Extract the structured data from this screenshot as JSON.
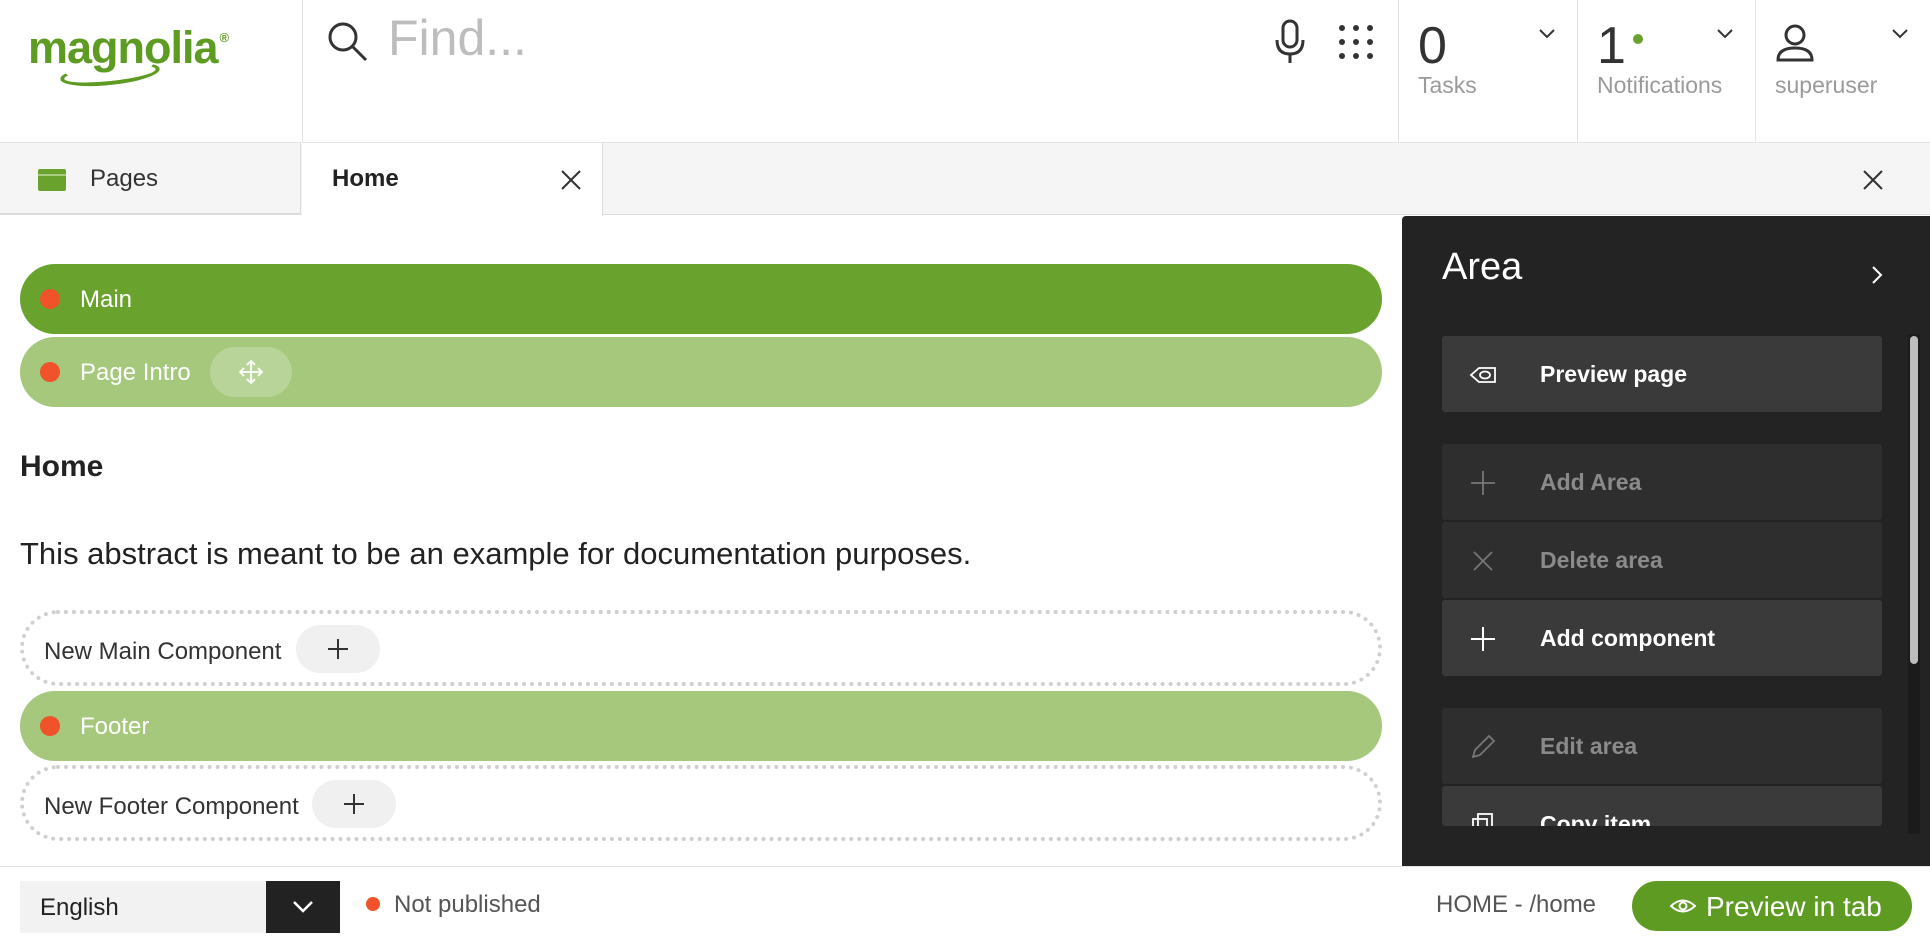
{
  "header": {
    "logo_text": "magnolia",
    "logo_mark": "®",
    "search": {
      "placeholder": "Find...",
      "value": ""
    },
    "tasks": {
      "count": "0",
      "label": "Tasks"
    },
    "notifications": {
      "count": "1",
      "label": "Notifications"
    },
    "user": {
      "label": "superuser"
    }
  },
  "tabs": {
    "pages_label": "Pages",
    "home_label": "Home"
  },
  "page": {
    "areas": {
      "main_label": "Main",
      "intro_label": "Page Intro",
      "footer_label": "Footer"
    },
    "heading": "Home",
    "abstract": "This abstract is meant to be an example for documentation purposes.",
    "new_main_component": "New Main Component",
    "new_footer_component": "New Footer Component"
  },
  "panel": {
    "title": "Area",
    "actions": {
      "preview": "Preview page",
      "add_area": "Add Area",
      "delete_area": "Delete area",
      "add_component": "Add component",
      "edit_area": "Edit area",
      "copy_item": "Copy item"
    }
  },
  "statusbar": {
    "language": "English",
    "publish_status": "Not published",
    "path": "HOME - /home",
    "preview_in_tab": "Preview in tab"
  },
  "colors": {
    "brand_green": "#5e9b22",
    "area_green": "#6aa22e",
    "area_light_green": "#a6c87d",
    "status_red": "#f0522a",
    "panel_dark": "#232323"
  },
  "icons": [
    "search-icon",
    "microphone-icon",
    "apps-grid-icon",
    "chevron-down-icon",
    "user-icon",
    "pages-app-icon",
    "close-icon",
    "move-icon",
    "plus-icon",
    "chevron-right-icon",
    "eye-preview-icon",
    "delete-x-icon",
    "pencil-icon",
    "copy-icon"
  ]
}
